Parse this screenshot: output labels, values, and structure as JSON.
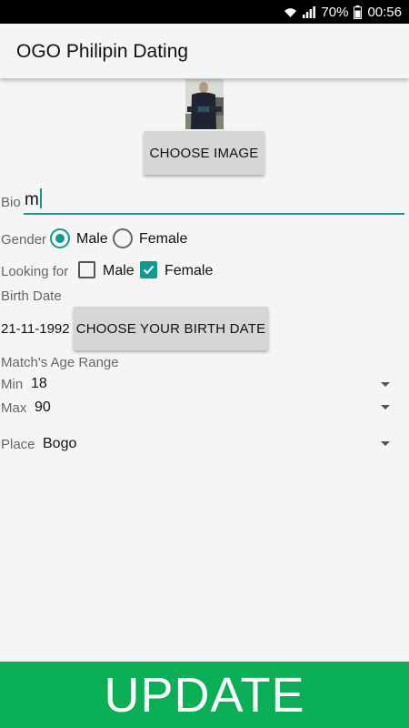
{
  "status_bar": {
    "battery": "70%",
    "time": "00:56"
  },
  "app_bar": {
    "title": "OGO Philipin Dating"
  },
  "profile": {
    "choose_image_label": "CHOOSE IMAGE"
  },
  "bio": {
    "label": "Bio",
    "value": "m"
  },
  "gender": {
    "label": "Gender",
    "options": [
      "Male",
      "Female"
    ],
    "selected": "Male"
  },
  "looking_for": {
    "label": "Looking for",
    "options": [
      {
        "label": "Male",
        "checked": false
      },
      {
        "label": "Female",
        "checked": true
      }
    ]
  },
  "birth_date": {
    "label": "Birth Date",
    "value": "21-11-1992",
    "button_label": "CHOOSE YOUR BIRTH DATE"
  },
  "age_range": {
    "label": "Match's Age Range",
    "min_label": "Min",
    "min_value": "18",
    "max_label": "Max",
    "max_value": "90"
  },
  "place": {
    "label": "Place",
    "value": "Bogo"
  },
  "update_button": {
    "label": "UPDATE"
  },
  "colors": {
    "accent": "#129a8e",
    "update_green": "#0aae54"
  }
}
